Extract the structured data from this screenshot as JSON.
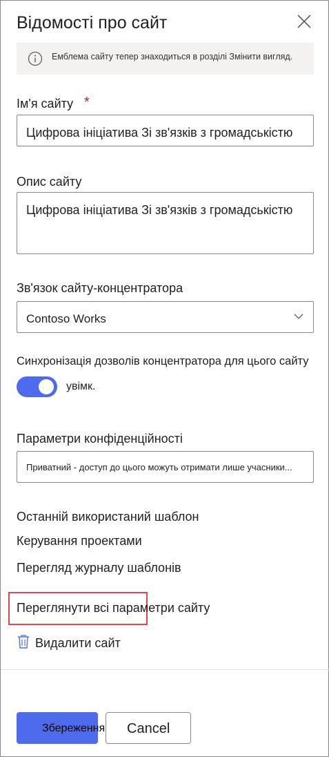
{
  "panel": {
    "title": "Відомості про сайт",
    "info_text": "Емблема сайту тепер знаходиться в розділі Змінити вигляд.",
    "site_name": {
      "label": "Ім'я сайту",
      "required_mark": "*",
      "value": "Цифрова ініціатива Зі зв'язків з громадськістю"
    },
    "site_description": {
      "label": "Опис сайту",
      "value": "Цифрова ініціатива Зі зв'язків з громадськістю"
    },
    "hub_association": {
      "label": "Зв'язок сайту-концентратора",
      "selected": "Contoso Works"
    },
    "hub_sync": {
      "label": "Синхронізація дозволів концентратора для цього сайту",
      "state_label": "увімк.",
      "on": true
    },
    "privacy": {
      "label": "Параметри конфіденційності",
      "selected": "Приватний - доступ до цього можуть отримати лише учасники..."
    },
    "links": {
      "last_template": "Останній використаний шаблон",
      "manage_projects": "Керування проектами",
      "template_history": "Перегляд журналу шаблонів",
      "all_settings": "Переглянути всі параметри сайту",
      "delete_site": "Видалити сайт"
    },
    "footer": {
      "save_label": "Збереження",
      "cancel_label": "Cancel"
    }
  },
  "colors": {
    "accent": "#4f6bed",
    "required": "#a4262c",
    "highlight_border": "#e0474c",
    "info_bg": "#f3f2f1"
  },
  "icons": [
    "close-icon",
    "info-icon",
    "chevron-down-icon",
    "trash-icon"
  ]
}
